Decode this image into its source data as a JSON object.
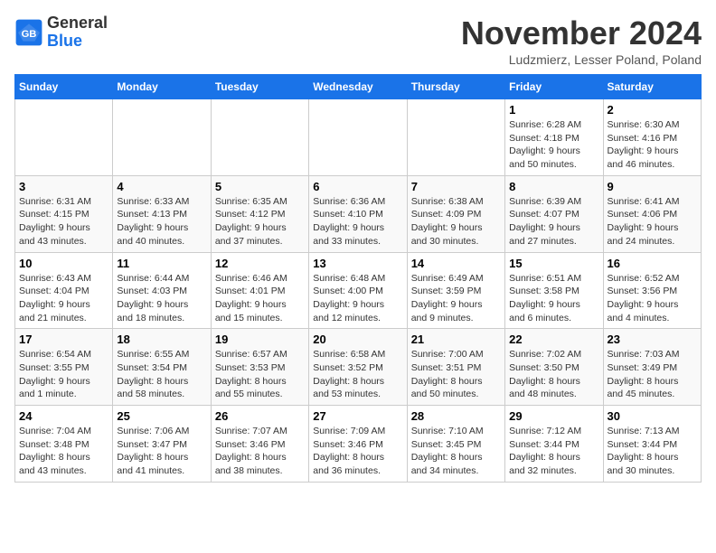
{
  "logo": {
    "general": "General",
    "blue": "Blue"
  },
  "header": {
    "month": "November 2024",
    "location": "Ludzmierz, Lesser Poland, Poland"
  },
  "weekdays": [
    "Sunday",
    "Monday",
    "Tuesday",
    "Wednesday",
    "Thursday",
    "Friday",
    "Saturday"
  ],
  "weeks": [
    [
      {
        "day": "",
        "info": ""
      },
      {
        "day": "",
        "info": ""
      },
      {
        "day": "",
        "info": ""
      },
      {
        "day": "",
        "info": ""
      },
      {
        "day": "",
        "info": ""
      },
      {
        "day": "1",
        "info": "Sunrise: 6:28 AM\nSunset: 4:18 PM\nDaylight: 9 hours\nand 50 minutes."
      },
      {
        "day": "2",
        "info": "Sunrise: 6:30 AM\nSunset: 4:16 PM\nDaylight: 9 hours\nand 46 minutes."
      }
    ],
    [
      {
        "day": "3",
        "info": "Sunrise: 6:31 AM\nSunset: 4:15 PM\nDaylight: 9 hours\nand 43 minutes."
      },
      {
        "day": "4",
        "info": "Sunrise: 6:33 AM\nSunset: 4:13 PM\nDaylight: 9 hours\nand 40 minutes."
      },
      {
        "day": "5",
        "info": "Sunrise: 6:35 AM\nSunset: 4:12 PM\nDaylight: 9 hours\nand 37 minutes."
      },
      {
        "day": "6",
        "info": "Sunrise: 6:36 AM\nSunset: 4:10 PM\nDaylight: 9 hours\nand 33 minutes."
      },
      {
        "day": "7",
        "info": "Sunrise: 6:38 AM\nSunset: 4:09 PM\nDaylight: 9 hours\nand 30 minutes."
      },
      {
        "day": "8",
        "info": "Sunrise: 6:39 AM\nSunset: 4:07 PM\nDaylight: 9 hours\nand 27 minutes."
      },
      {
        "day": "9",
        "info": "Sunrise: 6:41 AM\nSunset: 4:06 PM\nDaylight: 9 hours\nand 24 minutes."
      }
    ],
    [
      {
        "day": "10",
        "info": "Sunrise: 6:43 AM\nSunset: 4:04 PM\nDaylight: 9 hours\nand 21 minutes."
      },
      {
        "day": "11",
        "info": "Sunrise: 6:44 AM\nSunset: 4:03 PM\nDaylight: 9 hours\nand 18 minutes."
      },
      {
        "day": "12",
        "info": "Sunrise: 6:46 AM\nSunset: 4:01 PM\nDaylight: 9 hours\nand 15 minutes."
      },
      {
        "day": "13",
        "info": "Sunrise: 6:48 AM\nSunset: 4:00 PM\nDaylight: 9 hours\nand 12 minutes."
      },
      {
        "day": "14",
        "info": "Sunrise: 6:49 AM\nSunset: 3:59 PM\nDaylight: 9 hours\nand 9 minutes."
      },
      {
        "day": "15",
        "info": "Sunrise: 6:51 AM\nSunset: 3:58 PM\nDaylight: 9 hours\nand 6 minutes."
      },
      {
        "day": "16",
        "info": "Sunrise: 6:52 AM\nSunset: 3:56 PM\nDaylight: 9 hours\nand 4 minutes."
      }
    ],
    [
      {
        "day": "17",
        "info": "Sunrise: 6:54 AM\nSunset: 3:55 PM\nDaylight: 9 hours\nand 1 minute."
      },
      {
        "day": "18",
        "info": "Sunrise: 6:55 AM\nSunset: 3:54 PM\nDaylight: 8 hours\nand 58 minutes."
      },
      {
        "day": "19",
        "info": "Sunrise: 6:57 AM\nSunset: 3:53 PM\nDaylight: 8 hours\nand 55 minutes."
      },
      {
        "day": "20",
        "info": "Sunrise: 6:58 AM\nSunset: 3:52 PM\nDaylight: 8 hours\nand 53 minutes."
      },
      {
        "day": "21",
        "info": "Sunrise: 7:00 AM\nSunset: 3:51 PM\nDaylight: 8 hours\nand 50 minutes."
      },
      {
        "day": "22",
        "info": "Sunrise: 7:02 AM\nSunset: 3:50 PM\nDaylight: 8 hours\nand 48 minutes."
      },
      {
        "day": "23",
        "info": "Sunrise: 7:03 AM\nSunset: 3:49 PM\nDaylight: 8 hours\nand 45 minutes."
      }
    ],
    [
      {
        "day": "24",
        "info": "Sunrise: 7:04 AM\nSunset: 3:48 PM\nDaylight: 8 hours\nand 43 minutes."
      },
      {
        "day": "25",
        "info": "Sunrise: 7:06 AM\nSunset: 3:47 PM\nDaylight: 8 hours\nand 41 minutes."
      },
      {
        "day": "26",
        "info": "Sunrise: 7:07 AM\nSunset: 3:46 PM\nDaylight: 8 hours\nand 38 minutes."
      },
      {
        "day": "27",
        "info": "Sunrise: 7:09 AM\nSunset: 3:46 PM\nDaylight: 8 hours\nand 36 minutes."
      },
      {
        "day": "28",
        "info": "Sunrise: 7:10 AM\nSunset: 3:45 PM\nDaylight: 8 hours\nand 34 minutes."
      },
      {
        "day": "29",
        "info": "Sunrise: 7:12 AM\nSunset: 3:44 PM\nDaylight: 8 hours\nand 32 minutes."
      },
      {
        "day": "30",
        "info": "Sunrise: 7:13 AM\nSunset: 3:44 PM\nDaylight: 8 hours\nand 30 minutes."
      }
    ]
  ]
}
